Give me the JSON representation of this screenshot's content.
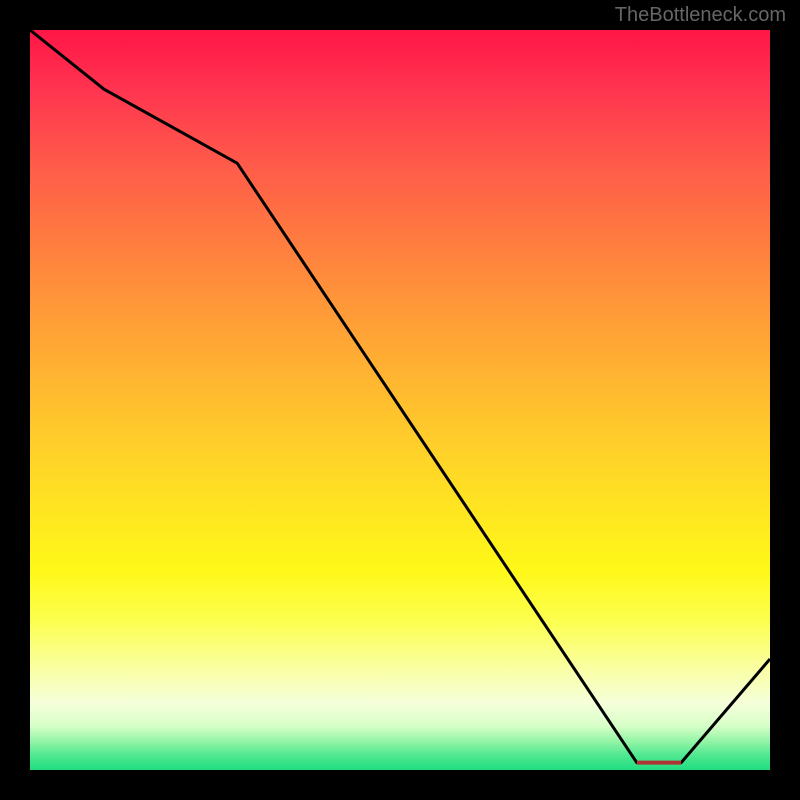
{
  "watermark": "TheBottleneck.com",
  "chart_data": {
    "type": "line",
    "x": [
      0,
      0.1,
      0.28,
      0.82,
      0.88,
      1.0
    ],
    "values": [
      100,
      92,
      82,
      1,
      1,
      15
    ],
    "ylim": [
      0,
      100
    ],
    "xlim": [
      0,
      1
    ],
    "title": "",
    "xlabel": "",
    "ylabel": "",
    "flat_region": {
      "x_start": 0.82,
      "x_end": 0.88,
      "y": 1
    }
  },
  "colors": {
    "line": "#000000",
    "flat_label": "#b03535",
    "gradient_top": "#ff1646",
    "gradient_bottom": "#20dd80"
  }
}
